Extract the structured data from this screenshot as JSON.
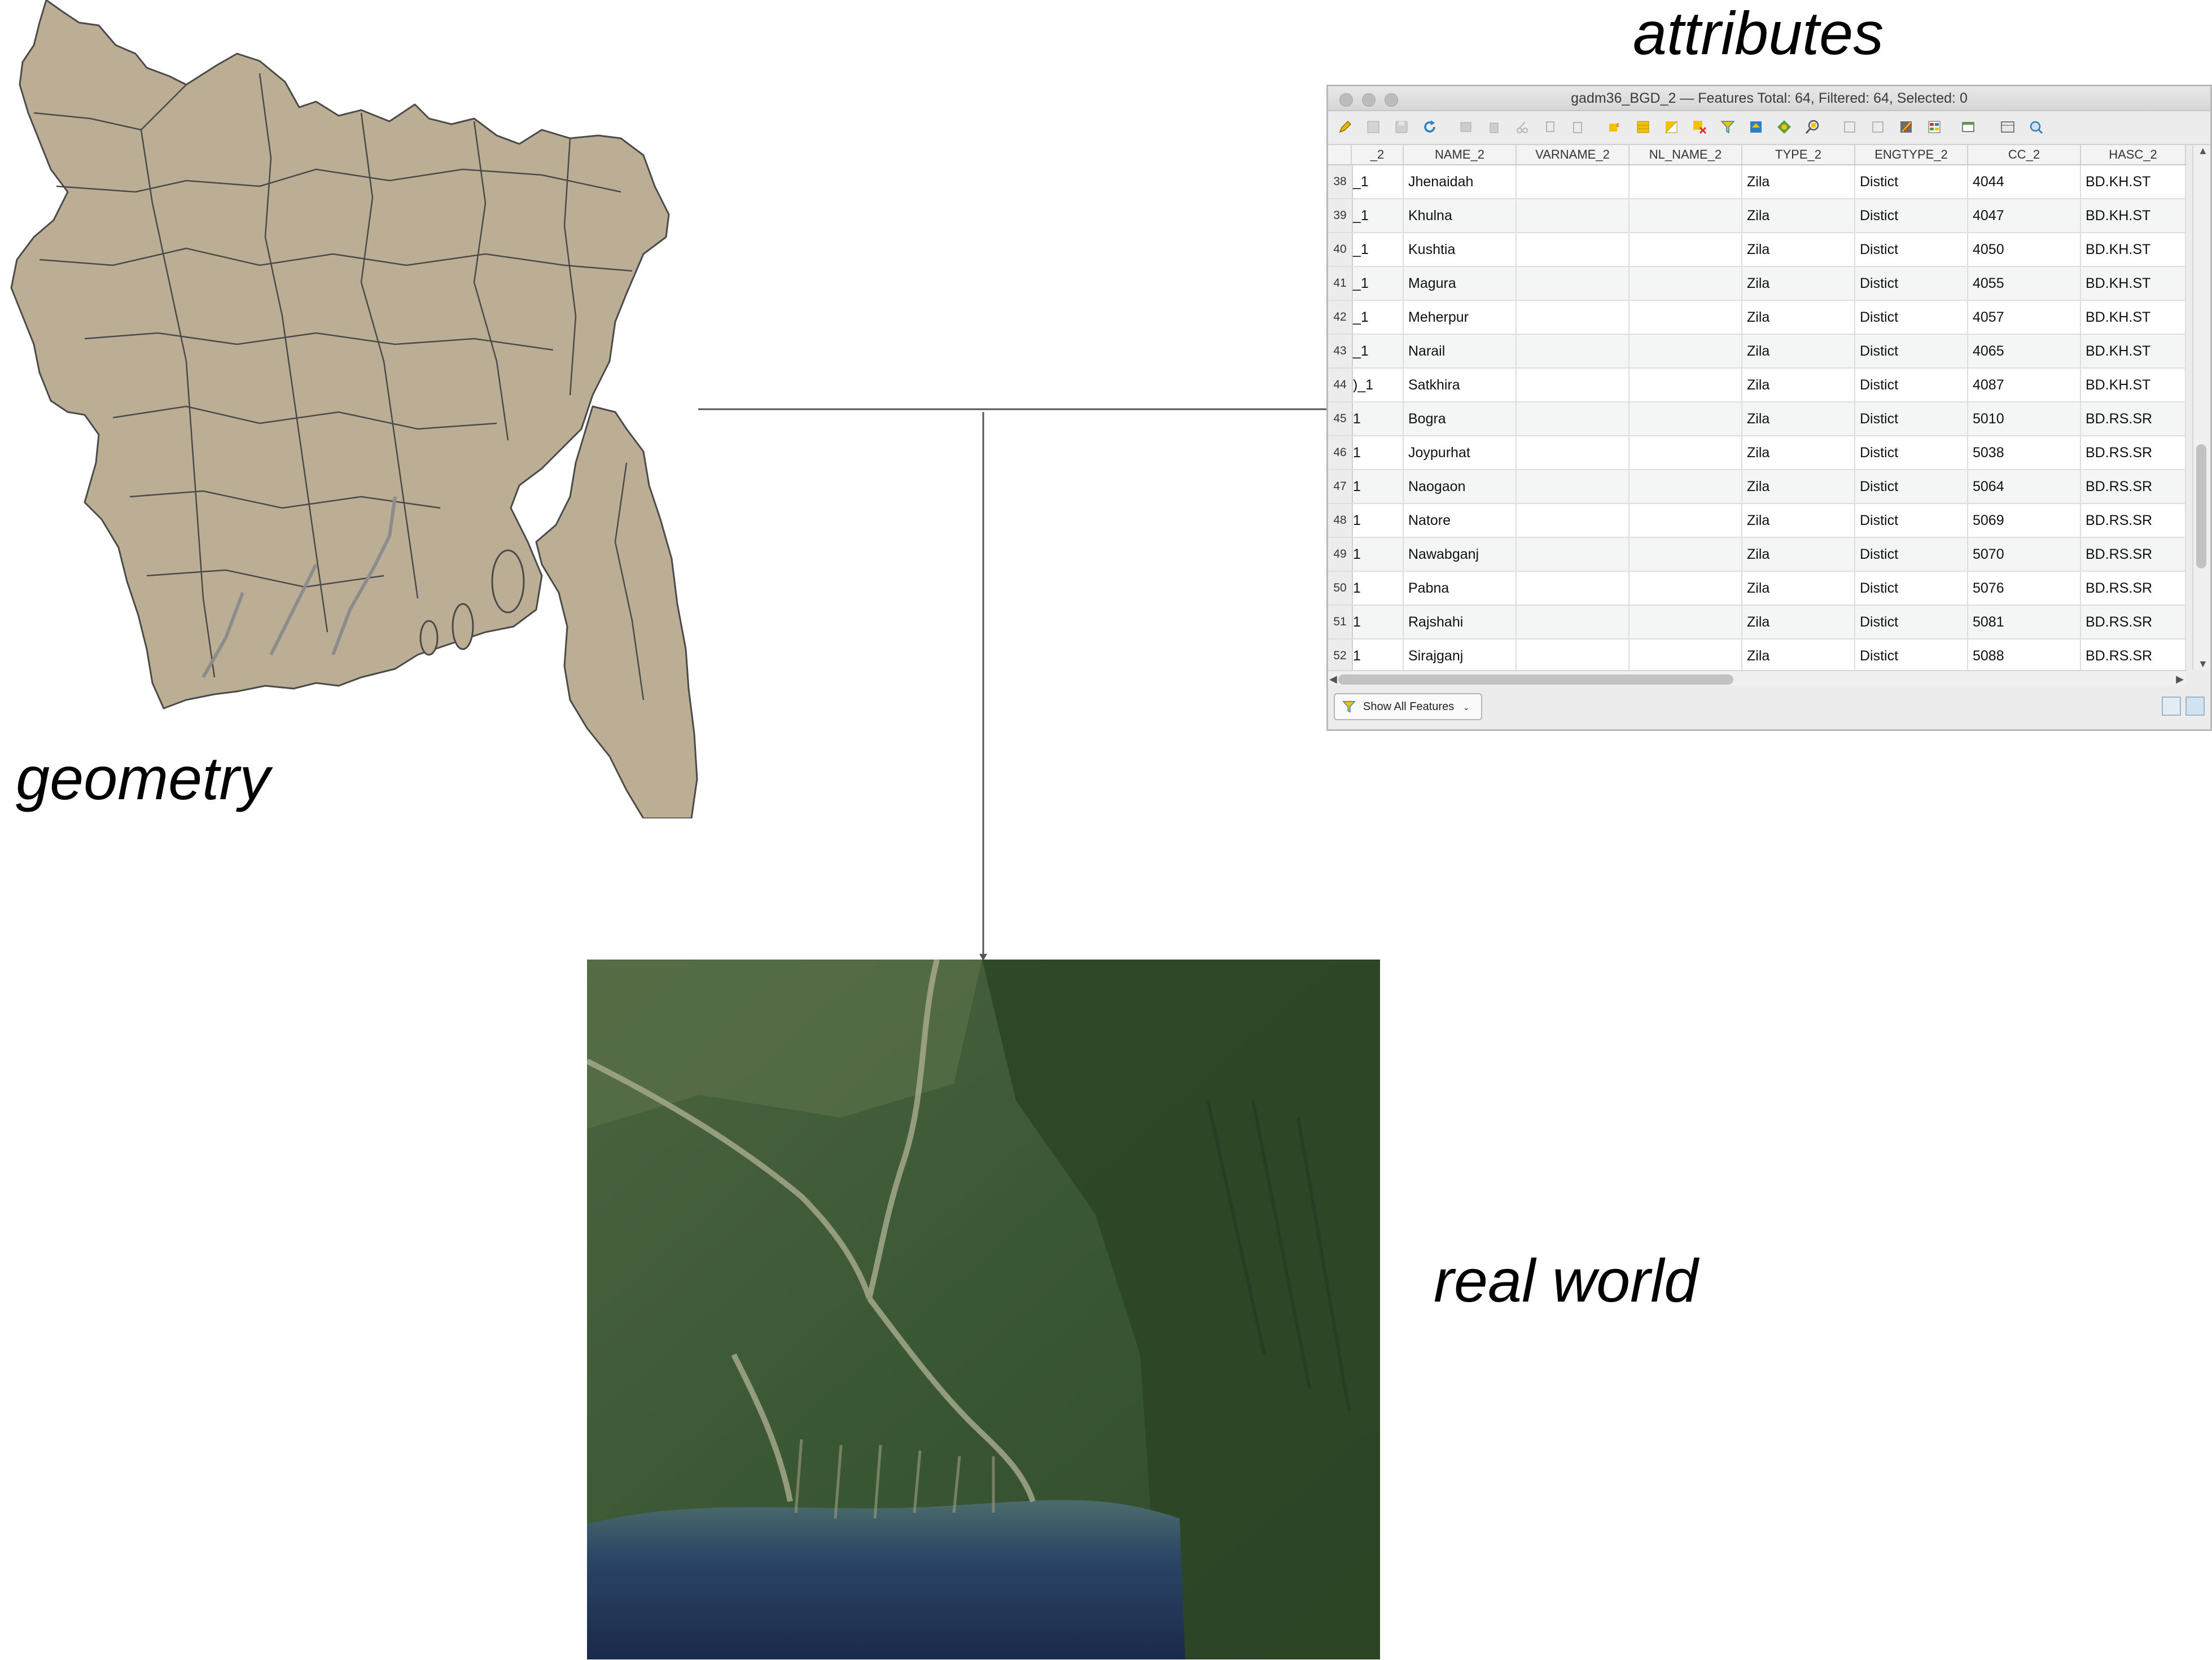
{
  "captions": {
    "attributes": "attributes",
    "geometry": "geometry",
    "real_world": "real world"
  },
  "attribute_table": {
    "window_title": "gadm36_BGD_2 — Features Total: 64, Filtered: 64, Selected: 0",
    "columns": [
      "_2",
      "NAME_2",
      "VARNAME_2",
      "NL_NAME_2",
      "TYPE_2",
      "ENGTYPE_2",
      "CC_2",
      "HASC_2"
    ],
    "rows": [
      {
        "num": "38",
        "c0": "_1",
        "name": "Jhenaidah",
        "type": "Zila",
        "engtype": "Distict",
        "cc": "4044",
        "hasc": "BD.KH.ST"
      },
      {
        "num": "39",
        "c0": "_1",
        "name": "Khulna",
        "type": "Zila",
        "engtype": "Distict",
        "cc": "4047",
        "hasc": "BD.KH.ST"
      },
      {
        "num": "40",
        "c0": "_1",
        "name": "Kushtia",
        "type": "Zila",
        "engtype": "Distict",
        "cc": "4050",
        "hasc": "BD.KH.ST"
      },
      {
        "num": "41",
        "c0": "_1",
        "name": "Magura",
        "type": "Zila",
        "engtype": "Distict",
        "cc": "4055",
        "hasc": "BD.KH.ST"
      },
      {
        "num": "42",
        "c0": "_1",
        "name": "Meherpur",
        "type": "Zila",
        "engtype": "Distict",
        "cc": "4057",
        "hasc": "BD.KH.ST"
      },
      {
        "num": "43",
        "c0": "_1",
        "name": "Narail",
        "type": "Zila",
        "engtype": "Distict",
        "cc": "4065",
        "hasc": "BD.KH.ST"
      },
      {
        "num": "44",
        "c0": ")_1",
        "name": "Satkhira",
        "type": "Zila",
        "engtype": "Distict",
        "cc": "4087",
        "hasc": "BD.KH.ST"
      },
      {
        "num": "45",
        "c0": "1",
        "name": "Bogra",
        "type": "Zila",
        "engtype": "Distict",
        "cc": "5010",
        "hasc": "BD.RS.SR"
      },
      {
        "num": "46",
        "c0": "1",
        "name": "Joypurhat",
        "type": "Zila",
        "engtype": "Distict",
        "cc": "5038",
        "hasc": "BD.RS.SR"
      },
      {
        "num": "47",
        "c0": "1",
        "name": "Naogaon",
        "type": "Zila",
        "engtype": "Distict",
        "cc": "5064",
        "hasc": "BD.RS.SR"
      },
      {
        "num": "48",
        "c0": "1",
        "name": "Natore",
        "type": "Zila",
        "engtype": "Distict",
        "cc": "5069",
        "hasc": "BD.RS.SR"
      },
      {
        "num": "49",
        "c0": "1",
        "name": "Nawabganj",
        "type": "Zila",
        "engtype": "Distict",
        "cc": "5070",
        "hasc": "BD.RS.SR"
      },
      {
        "num": "50",
        "c0": "1",
        "name": "Pabna",
        "type": "Zila",
        "engtype": "Distict",
        "cc": "5076",
        "hasc": "BD.RS.SR"
      },
      {
        "num": "51",
        "c0": "1",
        "name": "Rajshahi",
        "type": "Zila",
        "engtype": "Distict",
        "cc": "5081",
        "hasc": "BD.RS.SR"
      },
      {
        "num": "52",
        "c0": "1",
        "name": "Sirajganj",
        "type": "Zila",
        "engtype": "Distict",
        "cc": "5088",
        "hasc": "BD.RS.SR"
      }
    ],
    "show_all_label": "Show All Features"
  },
  "colors": {
    "map_fill": "#bcae94",
    "map_stroke": "#4a4a4a",
    "connector": "#555555"
  },
  "icons": [
    "pencil-icon",
    "toggle-multi-edit-icon",
    "save-edits-icon",
    "reload-icon",
    "add-feature-icon",
    "delete-feature-icon",
    "cut-icon",
    "copy-icon",
    "paste-icon",
    "select-by-expression-icon",
    "select-all-icon",
    "invert-selection-icon",
    "deselect-icon",
    "filter-icon",
    "move-to-top-icon",
    "pan-to-selected-icon",
    "zoom-to-selected-icon",
    "new-field-icon",
    "delete-field-icon",
    "field-calculator-icon",
    "conditional-formatting-icon",
    "dock-icon",
    "actions-icon",
    "form-view-icon",
    "table-view-icon"
  ]
}
